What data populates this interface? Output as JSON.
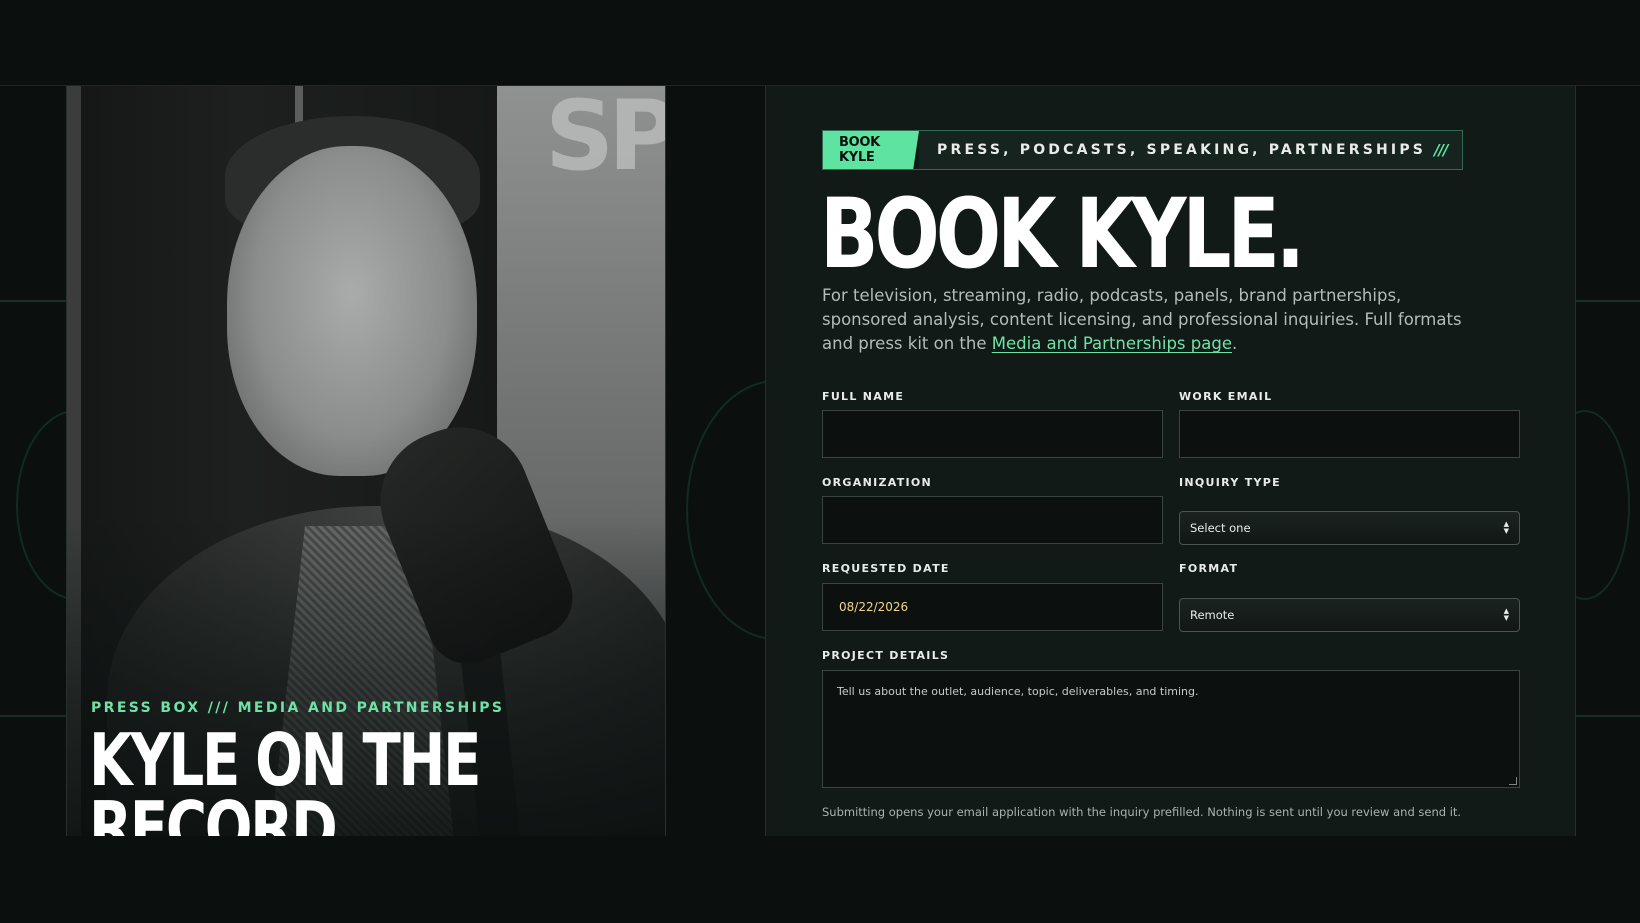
{
  "hero": {
    "kicker": "PRESS BOX /// MEDIA AND PARTNERSHIPS",
    "title_line1": "KYLE ON THE",
    "title_line2": "RECORD",
    "photo_sign_text": "SPO"
  },
  "form": {
    "badge": "BOOK KYLE",
    "tagline": "PRESS, PODCASTS, SPEAKING, PARTNERSHIPS",
    "tagline_slashes": "///",
    "title": "BOOK KYLE.",
    "intro_text": "For television, streaming, radio, podcasts, panels, brand partnerships, sponsored analysis, content licensing, and professional inquiries. Full formats and press kit on the ",
    "intro_link": "Media and Partnerships page",
    "intro_end": ".",
    "fields": {
      "full_name": {
        "label": "FULL NAME",
        "value": ""
      },
      "work_email": {
        "label": "WORK EMAIL",
        "value": ""
      },
      "organization": {
        "label": "ORGANIZATION",
        "value": ""
      },
      "inquiry_type": {
        "label": "INQUIRY TYPE",
        "selected": "Select one"
      },
      "requested_date": {
        "label": "REQUESTED DATE",
        "value": "08/22/2026"
      },
      "format": {
        "label": "FORMAT",
        "selected": "Remote"
      },
      "project_details": {
        "label": "PROJECT DETAILS",
        "placeholder": "Tell us about the outlet, audience, topic, deliverables, and timing."
      }
    },
    "footnote": "Submitting opens your email application with the inquiry prefilled. Nothing is sent until you review and send it."
  },
  "colors": {
    "accent": "#5fe3a1",
    "background": "#0b100f",
    "panel": "#121a17"
  }
}
